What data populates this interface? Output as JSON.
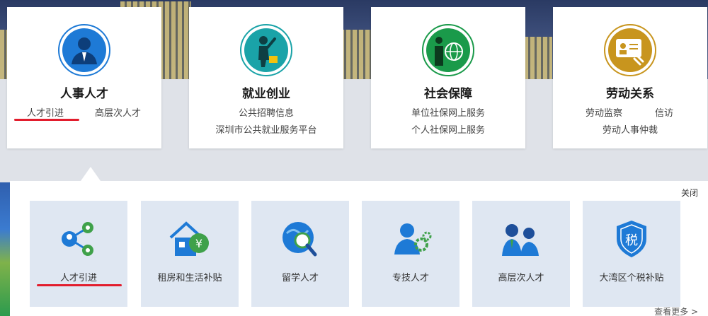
{
  "cards": [
    {
      "title": "人事人才",
      "links": [
        "人才引进",
        "高层次人才"
      ],
      "color": "#1e7ad6"
    },
    {
      "title": "就业创业",
      "links": [
        "公共招聘信息",
        "深圳市公共就业服务平台"
      ],
      "color": "#1aa3a8"
    },
    {
      "title": "社会保障",
      "links": [
        "单位社保网上服务",
        "个人社保网上服务"
      ],
      "color": "#1a9a4a"
    },
    {
      "title": "劳动关系",
      "links": [
        "劳动监察",
        "信访",
        "劳动人事仲裁"
      ],
      "color": "#c8951e"
    }
  ],
  "panel": {
    "close_label": "关闭",
    "more_label": "查看更多 >",
    "tiles": [
      {
        "label": "人才引进",
        "icon": "network-people-icon"
      },
      {
        "label": "租房和生活补贴",
        "icon": "house-yuan-icon"
      },
      {
        "label": "留学人才",
        "icon": "globe-magnifier-icon"
      },
      {
        "label": "专技人才",
        "icon": "person-gears-icon"
      },
      {
        "label": "高层次人才",
        "icon": "business-people-icon"
      },
      {
        "label": "大湾区个税补贴",
        "icon": "tax-shield-icon"
      }
    ]
  }
}
